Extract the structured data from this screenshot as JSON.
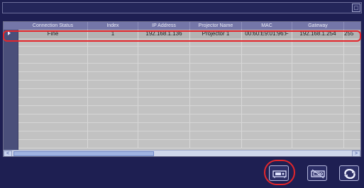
{
  "table": {
    "columns": [
      "Connection Status",
      "Index",
      "IP Address",
      "Projector Name",
      "MAC",
      "Gateway",
      ""
    ],
    "rows": [
      [
        "Fine",
        "1",
        "192.168.1.136",
        "Projector 1",
        "00:60:E9:01:96:F",
        "192.168.1.254",
        "255"
      ]
    ]
  },
  "scrollbar": {
    "left_arrow": "<",
    "right_arrow": ">"
  },
  "topbar": {
    "button_icon": "restore-icon"
  },
  "actions": {
    "icons": [
      "projector-connect-icon",
      "projector-disconnect-icon",
      "refresh-icon"
    ]
  },
  "colors": {
    "background": "#1e1f52",
    "header": "#7476a8",
    "selection_highlight": "#e3262b"
  }
}
